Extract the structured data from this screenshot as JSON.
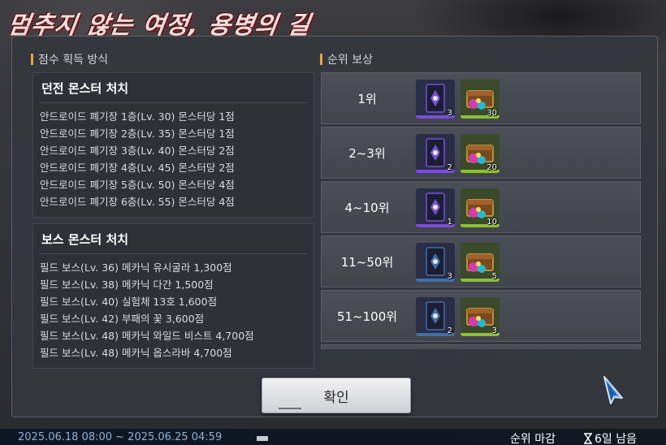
{
  "event_title": "멈추지 않는 여정, 용병의 길",
  "score_section": {
    "header": "점수 획득 방식",
    "dungeon": {
      "title": "던전 몬스터 처치",
      "rows": [
        "안드로이드 폐기장 1층(Lv. 30) 몬스터당 1점",
        "안드로이드 폐기장 2층(Lv. 35) 몬스터당 1점",
        "안드로이드 폐기장 3층(Lv. 40) 몬스터당 2점",
        "안드로이드 폐기장 4층(Lv. 45) 몬스터당 2점",
        "안드로이드 폐기장 5층(Lv. 50) 몬스터당 4점",
        "안드로이드 폐기장 6층(Lv. 55) 몬스터당 4점"
      ]
    },
    "boss": {
      "title": "보스 몬스터 처치",
      "rows": [
        "필드 보스(Lv. 36) 메카닉 유시굴라 1,300점",
        "필드 보스(Lv. 38) 메카닉 다간 1,500점",
        "필드 보스(Lv. 40) 실험체 13호 1,600점",
        "필드 보스(Lv. 42) 부패의 꽃 3,600점",
        "필드 보스(Lv. 48) 메카닉 와일드 비스트 4,700점",
        "필드 보스(Lv. 48) 메카닉 옵스라바 4,700점"
      ]
    }
  },
  "rank_section": {
    "header": "순위 보상",
    "rows": [
      {
        "rank": "1위",
        "card_tier": "purple",
        "card_count": "3",
        "chest_count": "30"
      },
      {
        "rank": "2~3위",
        "card_tier": "purple",
        "card_count": "2",
        "chest_count": "20"
      },
      {
        "rank": "4~10위",
        "card_tier": "purple",
        "card_count": "1",
        "chest_count": "10"
      },
      {
        "rank": "11~50위",
        "card_tier": "blue",
        "card_count": "3",
        "chest_count": "5"
      },
      {
        "rank": "51~100위",
        "card_tier": "blue",
        "card_count": "2",
        "chest_count": "3"
      },
      {
        "rank": "",
        "card_tier": "blue",
        "card_count": "",
        "chest_count": ""
      }
    ]
  },
  "confirm_label": "확인",
  "footer": {
    "period": "2025.06.18 08:00 ~ 2025.06.25 04:59",
    "deadline_label": "순위 마감",
    "remaining": "6일 남음"
  },
  "colors": {
    "accent_orange": "#e8a33a",
    "purple_tier": "#7b4fd0",
    "blue_tier": "#3f6fa8",
    "chest_frame": "#8bbf3a"
  },
  "icons": [
    "card-reward-icon",
    "chest-reward-icon",
    "hourglass-icon",
    "pointer-cursor-icon"
  ]
}
